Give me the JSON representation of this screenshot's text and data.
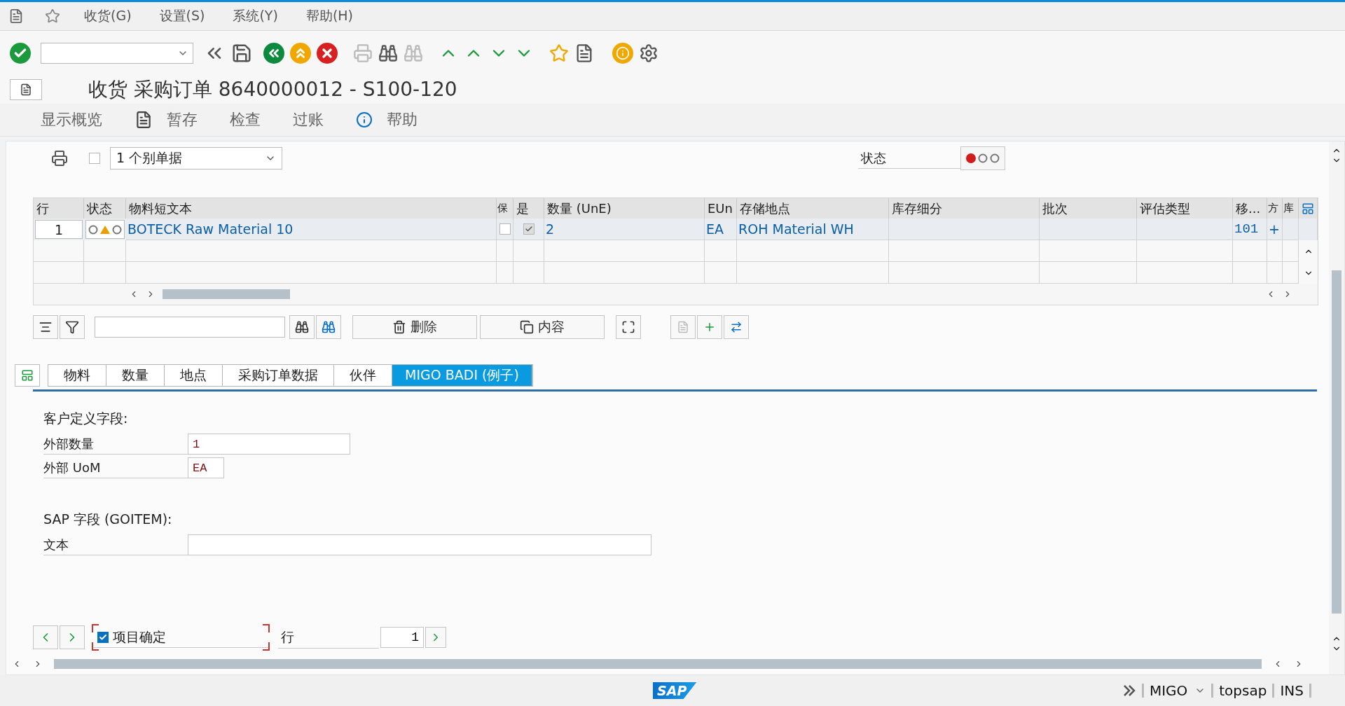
{
  "menu": [
    {
      "label": "收货(G)"
    },
    {
      "label": "设置(S)"
    },
    {
      "label": "系统(Y)"
    },
    {
      "label": "帮助(H)"
    }
  ],
  "title": "收货 采购订单 8640000012 - S100-120",
  "app_toolbar": [
    {
      "label": "显示概览"
    },
    {
      "label": "暂存"
    },
    {
      "label": "检查"
    },
    {
      "label": "过账"
    },
    {
      "label": "帮助"
    }
  ],
  "header": {
    "print_selected": false,
    "document_view": "1 个别单据",
    "status_label": "状态",
    "status_lights": [
      {
        "kind": "circle",
        "on": true,
        "color": "#d01c1c"
      },
      {
        "kind": "circle",
        "on": false
      },
      {
        "kind": "circle",
        "on": false
      }
    ]
  },
  "table": {
    "columns": [
      {
        "label": "行"
      },
      {
        "label": "状态"
      },
      {
        "label": "物料短文本"
      },
      {
        "label": "保"
      },
      {
        "label": "是"
      },
      {
        "label": "数量 (UnE)"
      },
      {
        "label": "EUn"
      },
      {
        "label": "存储地点"
      },
      {
        "label": "库存细分"
      },
      {
        "label": "批次"
      },
      {
        "label": "评估类型"
      },
      {
        "label": "移..."
      },
      {
        "label": "方"
      },
      {
        "label": "库"
      }
    ],
    "rows": [
      {
        "line": "1",
        "status": [
          {
            "kind": "circle",
            "on": false
          },
          {
            "kind": "triangle",
            "on": true,
            "color": "#e8a000"
          },
          {
            "kind": "circle",
            "on": false
          }
        ],
        "material": "BOTECK Raw Material 10",
        "flag_a": false,
        "flag_b": true,
        "quantity": "2",
        "unit": "EA",
        "storage_location": "ROH Material WH",
        "movement_type": "101",
        "direction": "+"
      }
    ]
  },
  "table_toolbar": {
    "buttons": [
      {
        "label": "删除"
      },
      {
        "label": "内容"
      }
    ]
  },
  "tabs": [
    {
      "label": "物料",
      "selected": false
    },
    {
      "label": "数量",
      "selected": false
    },
    {
      "label": "地点",
      "selected": false
    },
    {
      "label": "采购订单数据",
      "selected": false
    },
    {
      "label": "伙伴",
      "selected": false
    },
    {
      "label": "MIGO BADI (例子)",
      "selected": true
    }
  ],
  "custom_fields": {
    "heading": "客户定义字段:",
    "fields": [
      {
        "label": "外部数量",
        "value": "1"
      },
      {
        "label": "外部 UoM",
        "value": "EA"
      }
    ]
  },
  "sap_fields": {
    "heading": "SAP 字段 (GOITEM):",
    "fields": [
      {
        "label": "文本"
      }
    ]
  },
  "footer": {
    "item_ok": {
      "label": "项目确定",
      "checked": true
    },
    "line_label": "行",
    "line_value": "1"
  },
  "status_bar": {
    "logo": "SAP",
    "transaction": "MIGO",
    "user": "topsap",
    "mode": "INS"
  }
}
